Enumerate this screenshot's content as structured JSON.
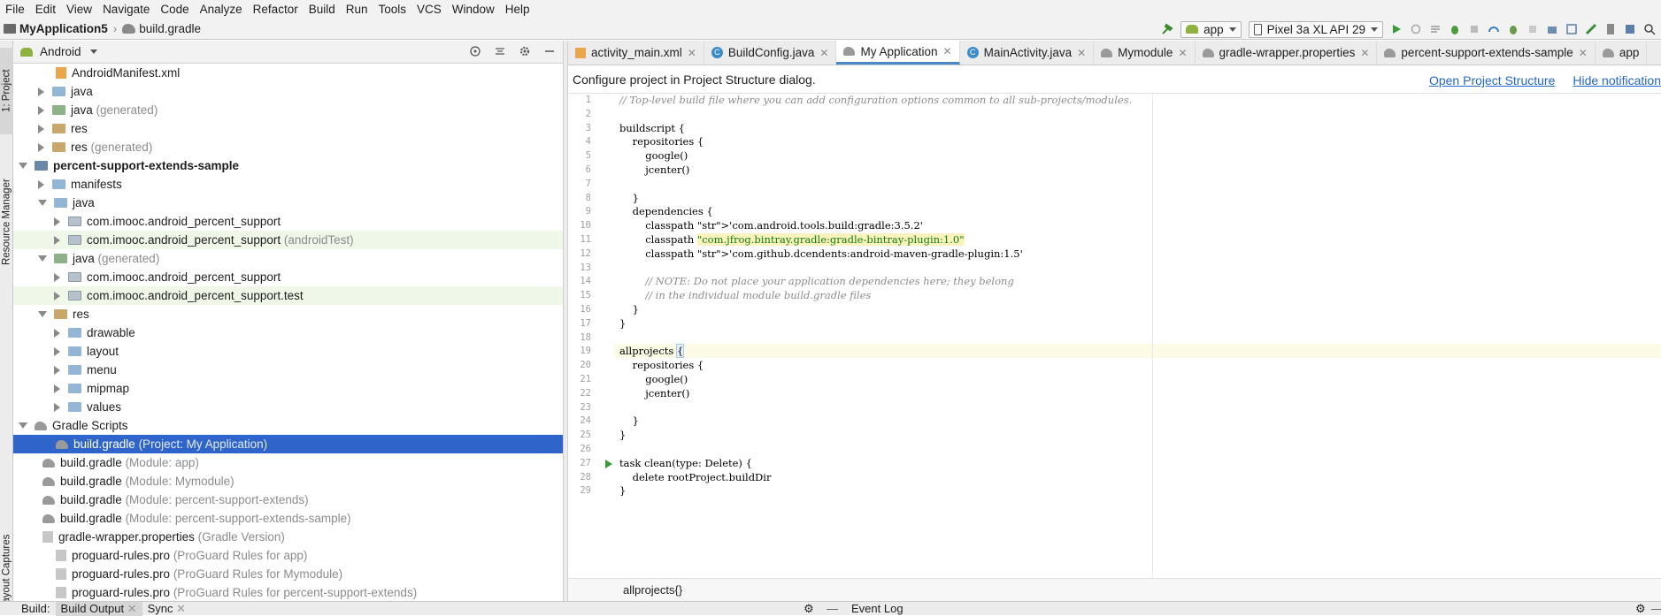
{
  "menu": [
    "File",
    "Edit",
    "View",
    "Navigate",
    "Code",
    "Analyze",
    "Refactor",
    "Build",
    "Run",
    "Tools",
    "VCS",
    "Window",
    "Help"
  ],
  "breadcrumb": {
    "project": "MyApplication5",
    "file": "build.gradle"
  },
  "run_config": {
    "module": "app",
    "device": "Pixel 3a XL API 29"
  },
  "left_stripe": {
    "project": "1: Project",
    "resource_manager": "Resource Manager",
    "layout_captures": "Layout Captures"
  },
  "project_panel": {
    "view": "Android"
  },
  "tree": [
    {
      "label": "AndroidManifest.xml",
      "suffix": "",
      "icon": "xml"
    },
    {
      "label": "java",
      "suffix": "",
      "icon": "folder"
    },
    {
      "label": "java",
      "suffix": " (generated)",
      "icon": "gen"
    },
    {
      "label": "res",
      "suffix": "",
      "icon": "res"
    },
    {
      "label": "res",
      "suffix": " (generated)",
      "icon": "res"
    },
    {
      "label": "percent-support-extends-sample",
      "suffix": "",
      "icon": "mod"
    },
    {
      "label": "manifests",
      "suffix": "",
      "icon": "folder"
    },
    {
      "label": "java",
      "suffix": "",
      "icon": "folder"
    },
    {
      "label": "com.imooc.android_percent_support",
      "suffix": "",
      "icon": "pkg"
    },
    {
      "label": "com.imooc.android_percent_support",
      "suffix": " (androidTest)",
      "icon": "pkg"
    },
    {
      "label": "java",
      "suffix": " (generated)",
      "icon": "gen"
    },
    {
      "label": "com.imooc.android_percent_support",
      "suffix": "",
      "icon": "pkg"
    },
    {
      "label": "com.imooc.android_percent_support.test",
      "suffix": "",
      "icon": "pkg"
    },
    {
      "label": "res",
      "suffix": "",
      "icon": "res"
    },
    {
      "label": "drawable",
      "suffix": "",
      "icon": "folder"
    },
    {
      "label": "layout",
      "suffix": "",
      "icon": "folder"
    },
    {
      "label": "menu",
      "suffix": "",
      "icon": "folder"
    },
    {
      "label": "mipmap",
      "suffix": "",
      "icon": "folder"
    },
    {
      "label": "values",
      "suffix": "",
      "icon": "folder"
    },
    {
      "label": "Gradle Scripts",
      "suffix": "",
      "icon": "gradle"
    },
    {
      "label": "build.gradle",
      "suffix": " (Project: My Application)",
      "icon": "gradle"
    },
    {
      "label": "build.gradle",
      "suffix": " (Module: app)",
      "icon": "gradle"
    },
    {
      "label": "build.gradle",
      "suffix": " (Module: Mymodule)",
      "icon": "gradle"
    },
    {
      "label": "build.gradle",
      "suffix": " (Module: percent-support-extends)",
      "icon": "gradle"
    },
    {
      "label": "build.gradle",
      "suffix": " (Module: percent-support-extends-sample)",
      "icon": "gradle"
    },
    {
      "label": "gradle-wrapper.properties",
      "suffix": " (Gradle Version)",
      "icon": "file"
    },
    {
      "label": "proguard-rules.pro",
      "suffix": " (ProGuard Rules for app)",
      "icon": "file"
    },
    {
      "label": "proguard-rules.pro",
      "suffix": " (ProGuard Rules for Mymodule)",
      "icon": "file"
    },
    {
      "label": "proguard-rules.pro",
      "suffix": " (ProGuard Rules for percent-support-extends)",
      "icon": "file"
    }
  ],
  "tabs": [
    {
      "label": "activity_main.xml",
      "icon": "xml",
      "active": false
    },
    {
      "label": "BuildConfig.java",
      "icon": "class",
      "active": false
    },
    {
      "label": "My Application",
      "icon": "gradle",
      "active": true
    },
    {
      "label": "MainActivity.java",
      "icon": "class",
      "active": false
    },
    {
      "label": "Mymodule",
      "icon": "gradle",
      "active": false
    },
    {
      "label": "gradle-wrapper.properties",
      "icon": "props",
      "active": false
    },
    {
      "label": "percent-support-extends-sample",
      "icon": "gradle",
      "active": false
    },
    {
      "label": "app",
      "icon": "gradle",
      "active": false
    }
  ],
  "notification": {
    "text": "Configure project in Project Structure dialog.",
    "open": "Open Project Structure",
    "hide": "Hide notification"
  },
  "code_lines": [
    "// Top-level build file where you can add configuration options common to all sub-projects/modules.",
    "",
    "buildscript {",
    "    repositories {",
    "        google()",
    "        jcenter()",
    "",
    "    }",
    "    dependencies {",
    "        classpath 'com.android.tools.build:gradle:3.5.2'",
    "        classpath \"com.jfrog.bintray.gradle:gradle-bintray-plugin:1.0\"",
    "        classpath 'com.github.dcendents:android-maven-gradle-plugin:1.5'",
    "",
    "        // NOTE: Do not place your application dependencies here; they belong",
    "        // in the individual module build.gradle files",
    "    }",
    "}",
    "",
    "allprojects {",
    "    repositories {",
    "        google()",
    "        jcenter()",
    "",
    "    }",
    "}",
    "",
    "task clean(type: Delete) {",
    "    delete rootProject.buildDir",
    "}"
  ],
  "editor_breadcrumb": "allprojects{}",
  "bottom": {
    "build": "Build:",
    "build_output": "Build Output",
    "sync": "Sync",
    "event_log": "Event Log"
  }
}
